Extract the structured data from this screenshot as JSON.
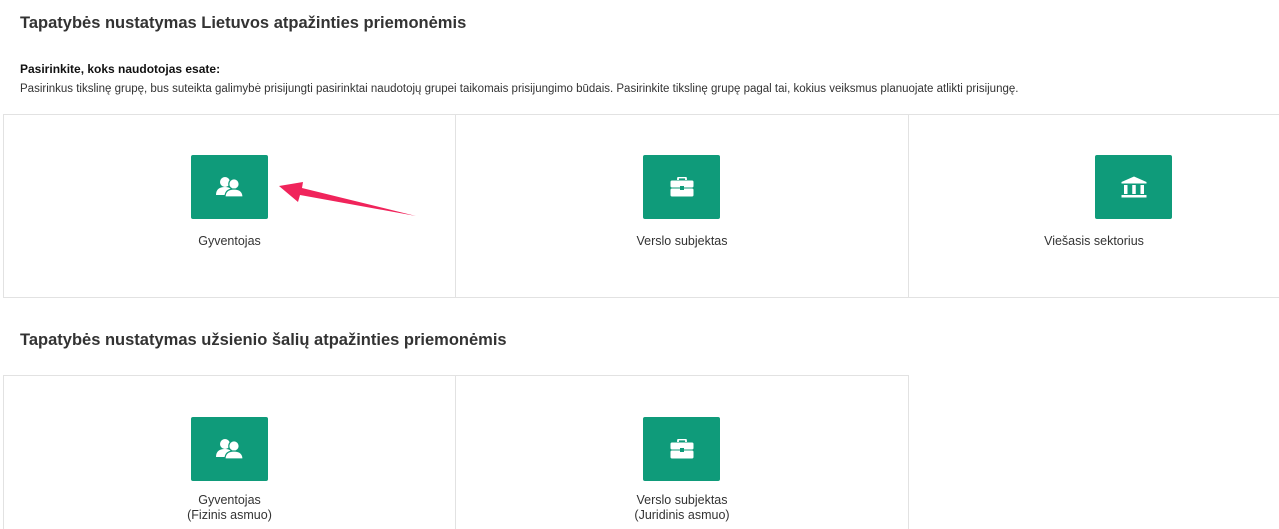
{
  "lithuanian_section": {
    "title": "Tapatybės nustatymas Lietuvos atpažinties priemonėmis",
    "prompt": "Pasirinkite, koks naudotojas esate:",
    "description": "Pasirinkus tikslinę grupę, bus suteikta galimybė prisijungti pasirinktai naudotojų grupei taikomais prisijungimo būdais. Pasirinkite tikslinę grupę pagal tai, kokius veiksmus planuojate atlikti prisijungę.",
    "tiles": [
      {
        "label": "Gyventojas",
        "icon": "users-icon"
      },
      {
        "label": "Verslo subjektas",
        "icon": "briefcase-icon"
      },
      {
        "label": "Viešasis sektorius",
        "icon": "institution-icon"
      }
    ]
  },
  "foreign_section": {
    "title": "Tapatybės nustatymas užsienio šalių atpažinties priemonėmis",
    "tiles": [
      {
        "label": "Gyventojas",
        "sublabel": "(Fizinis asmuo)",
        "icon": "users-icon"
      },
      {
        "label": "Verslo subjektas",
        "sublabel": "(Juridinis asmuo)",
        "icon": "briefcase-icon"
      }
    ]
  },
  "colors": {
    "tile_accent": "#0f9b7a",
    "annotation_arrow": "#f0245b",
    "border": "#e2e2e2"
  }
}
